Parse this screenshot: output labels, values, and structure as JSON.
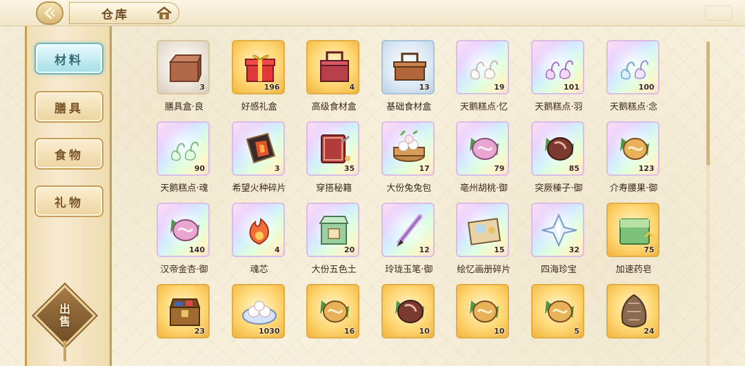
{
  "header": {
    "title": "仓库",
    "back_icon": "back-arrow-icon",
    "home_icon": "house-icon"
  },
  "sidebar": {
    "tabs": [
      {
        "label": "材料",
        "active": true
      },
      {
        "label": "膳具",
        "active": false
      },
      {
        "label": "食物",
        "active": false
      },
      {
        "label": "礼物",
        "active": false
      }
    ],
    "sell_line1": "出",
    "sell_line2": "售"
  },
  "colors": {
    "active_tab": "#a4dfe6",
    "gold_quality": "#ffd774",
    "rainbow_quality": "#e3c8ff"
  },
  "items": [
    {
      "name": "膳具盒·良",
      "count": "3",
      "quality": "gray",
      "icon": "tableware-box-icon",
      "art": "box-brown"
    },
    {
      "name": "好感礼盒",
      "count": "196",
      "quality": "gold",
      "icon": "gift-box-icon",
      "art": "gift"
    },
    {
      "name": "高级食材盒",
      "count": "4",
      "quality": "gold",
      "icon": "premium-food-basket-icon",
      "art": "basket-red"
    },
    {
      "name": "基础食材盒",
      "count": "13",
      "quality": "blue",
      "icon": "basic-food-basket-icon",
      "art": "basket-brown"
    },
    {
      "name": "天鹅糕点·忆",
      "count": "19",
      "quality": "rain",
      "icon": "swan-pastry-icon",
      "art": "swan-white"
    },
    {
      "name": "天鹅糕点·羽",
      "count": "101",
      "quality": "rain",
      "icon": "swan-pastry-icon",
      "art": "swan-purple"
    },
    {
      "name": "天鹅糕点·念",
      "count": "100",
      "quality": "rain",
      "icon": "swan-pastry-icon",
      "art": "swan-blue"
    },
    {
      "name": "天鹅糕点·魂",
      "count": "90",
      "quality": "rain",
      "icon": "swan-pastry-icon",
      "art": "swan-green"
    },
    {
      "name": "希望火种碎片",
      "count": "3",
      "quality": "rain",
      "icon": "fire-fragment-icon",
      "art": "fire-fragment"
    },
    {
      "name": "穿搭秘籍",
      "count": "35",
      "quality": "rain",
      "icon": "book-icon",
      "art": "book"
    },
    {
      "name": "大份兔兔包",
      "count": "17",
      "quality": "rain",
      "icon": "bunny-bun-icon",
      "art": "steamer"
    },
    {
      "name": "亳州胡桃·御",
      "count": "79",
      "quality": "rain",
      "icon": "walnut-icon",
      "art": "nut-pink"
    },
    {
      "name": "突厥榛子·御",
      "count": "85",
      "quality": "rain",
      "icon": "hazelnut-icon",
      "art": "nut-dark"
    },
    {
      "name": "介寿腰果·御",
      "count": "123",
      "quality": "rain",
      "icon": "cashew-icon",
      "art": "nut-gold"
    },
    {
      "name": "汉帝金杏·御",
      "count": "140",
      "quality": "rain",
      "icon": "apricot-icon",
      "art": "nut-pink"
    },
    {
      "name": "魂芯",
      "count": "4",
      "quality": "rain",
      "icon": "soul-core-icon",
      "art": "flame"
    },
    {
      "name": "大份五色土",
      "count": "20",
      "quality": "rain",
      "icon": "five-color-soil-icon",
      "art": "jade-box"
    },
    {
      "name": "玲珑玉笔·御",
      "count": "12",
      "quality": "rain",
      "icon": "jade-brush-icon",
      "art": "brush"
    },
    {
      "name": "绘忆画册碎片",
      "count": "15",
      "quality": "rain",
      "icon": "album-fragment-icon",
      "art": "album"
    },
    {
      "name": "四海珍宝",
      "count": "32",
      "quality": "rain",
      "icon": "sea-treasure-icon",
      "art": "crystal"
    },
    {
      "name": "加速药皂",
      "count": "75",
      "quality": "gold",
      "icon": "soap-icon",
      "art": "soap"
    },
    {
      "name": "",
      "count": "23",
      "quality": "gold",
      "icon": "treasure-chest-icon",
      "art": "chest"
    },
    {
      "name": "",
      "count": "1030",
      "quality": "gold",
      "icon": "bunny-dumpling-icon",
      "art": "plate"
    },
    {
      "name": "",
      "count": "16",
      "quality": "gold",
      "icon": "walnut-icon",
      "art": "nut-gold"
    },
    {
      "name": "",
      "count": "10",
      "quality": "gold",
      "icon": "hazelnut-icon",
      "art": "nut-dark"
    },
    {
      "name": "",
      "count": "10",
      "quality": "gold",
      "icon": "cashew-icon",
      "art": "nut-gold"
    },
    {
      "name": "",
      "count": "5",
      "quality": "gold",
      "icon": "apricot-icon",
      "art": "nut-gold"
    },
    {
      "name": "",
      "count": "24",
      "quality": "gold",
      "icon": "bundle-icon",
      "art": "bundle"
    }
  ]
}
